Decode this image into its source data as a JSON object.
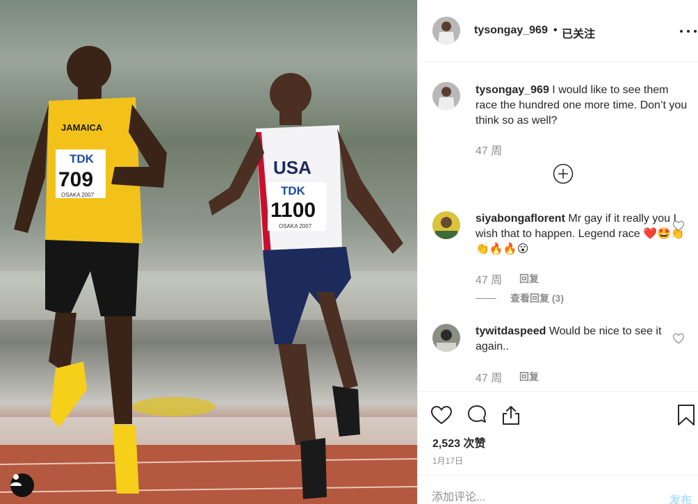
{
  "post": {
    "author": "tysongay_969",
    "separator": "•",
    "follow_status": "已关注",
    "caption": {
      "username": "tysongay_969",
      "text": "I would like to see them race the hundred one more time. Don’t you think so as well?",
      "age": "47 周"
    },
    "athletes": {
      "left": {
        "country": "JAMAICA",
        "sponsor": "TDK",
        "bib": "709",
        "event": "OSAKA 2007"
      },
      "right": {
        "country": "USA",
        "sponsor": "TDK",
        "bib": "1100",
        "event": "OSAKA 2007"
      }
    },
    "comments": [
      {
        "username": "siyabongaflorent",
        "text": "Mr gay if it really you I wish that to happen. Legend race ❤️🤩👏👏🔥🔥😮",
        "age": "47 周",
        "reply_label": "回复",
        "view_replies": "查看回复 (3)"
      },
      {
        "username": "tywitdaspeed",
        "text": "Would be nice to see it again..",
        "age": "47 周",
        "reply_label": "回复"
      }
    ],
    "likes": "2,523 次赞",
    "date": "1月17日",
    "comment_box": {
      "placeholder": "添加评论...",
      "submit_label": "发布"
    }
  },
  "icons": [
    "more-icon",
    "add-circle-icon",
    "heart-icon",
    "comment-icon",
    "share-icon",
    "bookmark-icon",
    "user-tag-icon"
  ],
  "colors": {
    "text": "#262626",
    "secondary": "#8e8e8e",
    "post_disabled": "#b2dffc",
    "divider": "#efefef",
    "heart_emoji": "#e0245e"
  }
}
